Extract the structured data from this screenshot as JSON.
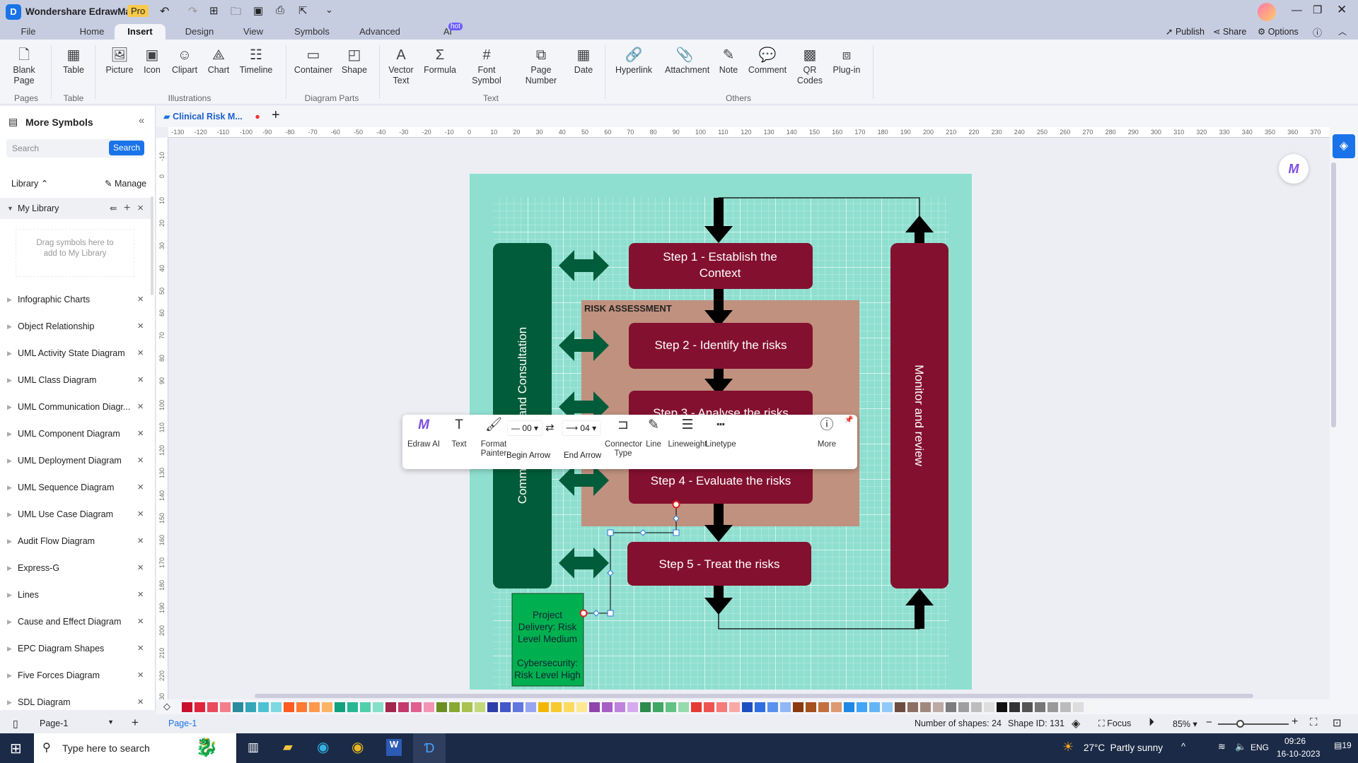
{
  "app": {
    "title": "Wondershare EdrawMax",
    "badge": "Pro",
    "publish": "Publish",
    "share": "Share",
    "options": "Options"
  },
  "menu_tabs": [
    "File",
    "Home",
    "Insert",
    "Design",
    "View",
    "Symbols",
    "Advanced",
    "AI"
  ],
  "ai_badge": "hot",
  "ribbon": {
    "buttons": [
      {
        "label": "Blank Page",
        "icon": "page-icon"
      },
      {
        "label": "Table",
        "icon": "table-icon"
      },
      {
        "label": "Picture",
        "icon": "picture-icon"
      },
      {
        "label": "Icon",
        "icon": "icon-icon"
      },
      {
        "label": "Clipart",
        "icon": "clipart-icon"
      },
      {
        "label": "Chart",
        "icon": "chart-icon"
      },
      {
        "label": "Timeline",
        "icon": "timeline-icon"
      },
      {
        "label": "Container",
        "icon": "container-icon"
      },
      {
        "label": "Shape",
        "icon": "shape-icon"
      },
      {
        "label": "Vector Text",
        "icon": "vector-text-icon"
      },
      {
        "label": "Formula",
        "icon": "formula-icon"
      },
      {
        "label": "Font Symbol",
        "icon": "hash-icon"
      },
      {
        "label": "Page Number",
        "icon": "page-number-icon"
      },
      {
        "label": "Date",
        "icon": "calendar-icon"
      },
      {
        "label": "Hyperlink",
        "icon": "link-icon"
      },
      {
        "label": "Attachment",
        "icon": "paperclip-icon"
      },
      {
        "label": "Note",
        "icon": "note-icon"
      },
      {
        "label": "Comment",
        "icon": "comment-icon"
      },
      {
        "label": "QR Codes",
        "icon": "qr-icon"
      },
      {
        "label": "Plug-in",
        "icon": "plugin-icon"
      }
    ],
    "groups": [
      "Pages",
      "Table",
      "Illustrations",
      "Diagram Parts",
      "Text",
      "Others"
    ]
  },
  "sidebar": {
    "title": "More Symbols",
    "search_placeholder": "Search",
    "search_button": "Search",
    "library_label": "Library",
    "manage": "Manage",
    "my_library": "My Library",
    "drop_hint": "Drag symbols here to add to My Library",
    "libraries": [
      "Infographic Charts",
      "Object Relationship",
      "UML Activity State Diagram",
      "UML Class Diagram",
      "UML Communication Diagr...",
      "UML Component Diagram",
      "UML Deployment Diagram",
      "UML Sequence Diagram",
      "UML Use Case Diagram",
      "Audit Flow Diagram",
      "Express-G",
      "Lines",
      "Cause and Effect Diagram",
      "EPC Diagram Shapes",
      "Five Forces Diagram",
      "SDL Diagram"
    ]
  },
  "document": {
    "tab": "Clinical Risk M...",
    "unsaved": true
  },
  "diagram": {
    "left_bar": "Communication and Consultation",
    "right_bar": "Monitor and review",
    "risk_assessment": "RISK ASSESSMENT",
    "steps": [
      "Step 1 - Establish the Context",
      "Step 2 - Identify  the risks",
      "Step 3 - Analyse the risks",
      "Step 4 - Evaluate the risks",
      "Step 5 - Treat the risks"
    ],
    "note_line1": "Project Delivery: Risk Level Medium",
    "note_line2": "Cybersecurity: Risk Level High",
    "colors": {
      "page": "#8fdfd0",
      "green_bar": "#005c3a",
      "maroon": "#84102f",
      "assessment": "#c0917e",
      "note": "#00b050"
    }
  },
  "float_toolbar": {
    "edraw_ai": "Edraw AI",
    "text": "Text",
    "format_painter": "Format Painter",
    "begin_value": "00",
    "begin_arrow": "Begin Arrow",
    "end_value": "04",
    "end_arrow": "End Arrow",
    "connector_type": "Connector Type",
    "line": "Line",
    "lineweight": "Lineweight",
    "linetype": "Linetype",
    "more": "More"
  },
  "palette": [
    "#c8102e",
    "#e0243c",
    "#e84b5c",
    "#f47f8c",
    "#2a8c9e",
    "#34a6b8",
    "#4cc2d2",
    "#7ed8e2",
    "#ff5a1f",
    "#ff7a33",
    "#ff9a4d",
    "#ffb366",
    "#12a17f",
    "#27b893",
    "#4fcfac",
    "#86e0c8",
    "#a3264f",
    "#c43a6a",
    "#e05f8c",
    "#f295b5",
    "#6b8e23",
    "#88a834",
    "#a7c24d",
    "#c4d97a",
    "#2e3fa8",
    "#4357c9",
    "#6377e0",
    "#95a5f0",
    "#f2b705",
    "#f7c92e",
    "#fadb5e",
    "#fde992",
    "#8e44ad",
    "#a55fc7",
    "#be83dd",
    "#d6aaee",
    "#2d8b4e",
    "#3fa863",
    "#62c283",
    "#97dbac",
    "#e53935",
    "#ef5350",
    "#f47c7a",
    "#f9a8a6",
    "#1e4fc2",
    "#2f6ee0",
    "#5a91ee",
    "#90b7f6",
    "#8b3a0f",
    "#a5501f",
    "#c2703e",
    "#dd9a70",
    "#1e88e5",
    "#42a5f5",
    "#64b5f6",
    "#90caf9",
    "#6d4c41",
    "#8d6e63",
    "#a1887f",
    "#bcaaa4",
    "#7d7d7d",
    "#9e9e9e",
    "#bdbdbd",
    "#dedede",
    "#111111",
    "#333333",
    "#555555",
    "#777777",
    "#999999",
    "#bbbbbb",
    "#dddddd",
    "#f5f5f5"
  ],
  "status": {
    "page_select": "Page-1",
    "page_tab": "Page-1",
    "shapes": "Number of shapes: 24",
    "shape_id": "Shape ID: 131",
    "focus": "Focus",
    "zoom": "85%",
    "zoom_level": 85
  },
  "taskbar": {
    "search": "Type here to search",
    "weather": "27°C  Partly sunny",
    "lang": "ENG",
    "time": "09:26",
    "date": "16-10-2023",
    "notifications": "19"
  }
}
